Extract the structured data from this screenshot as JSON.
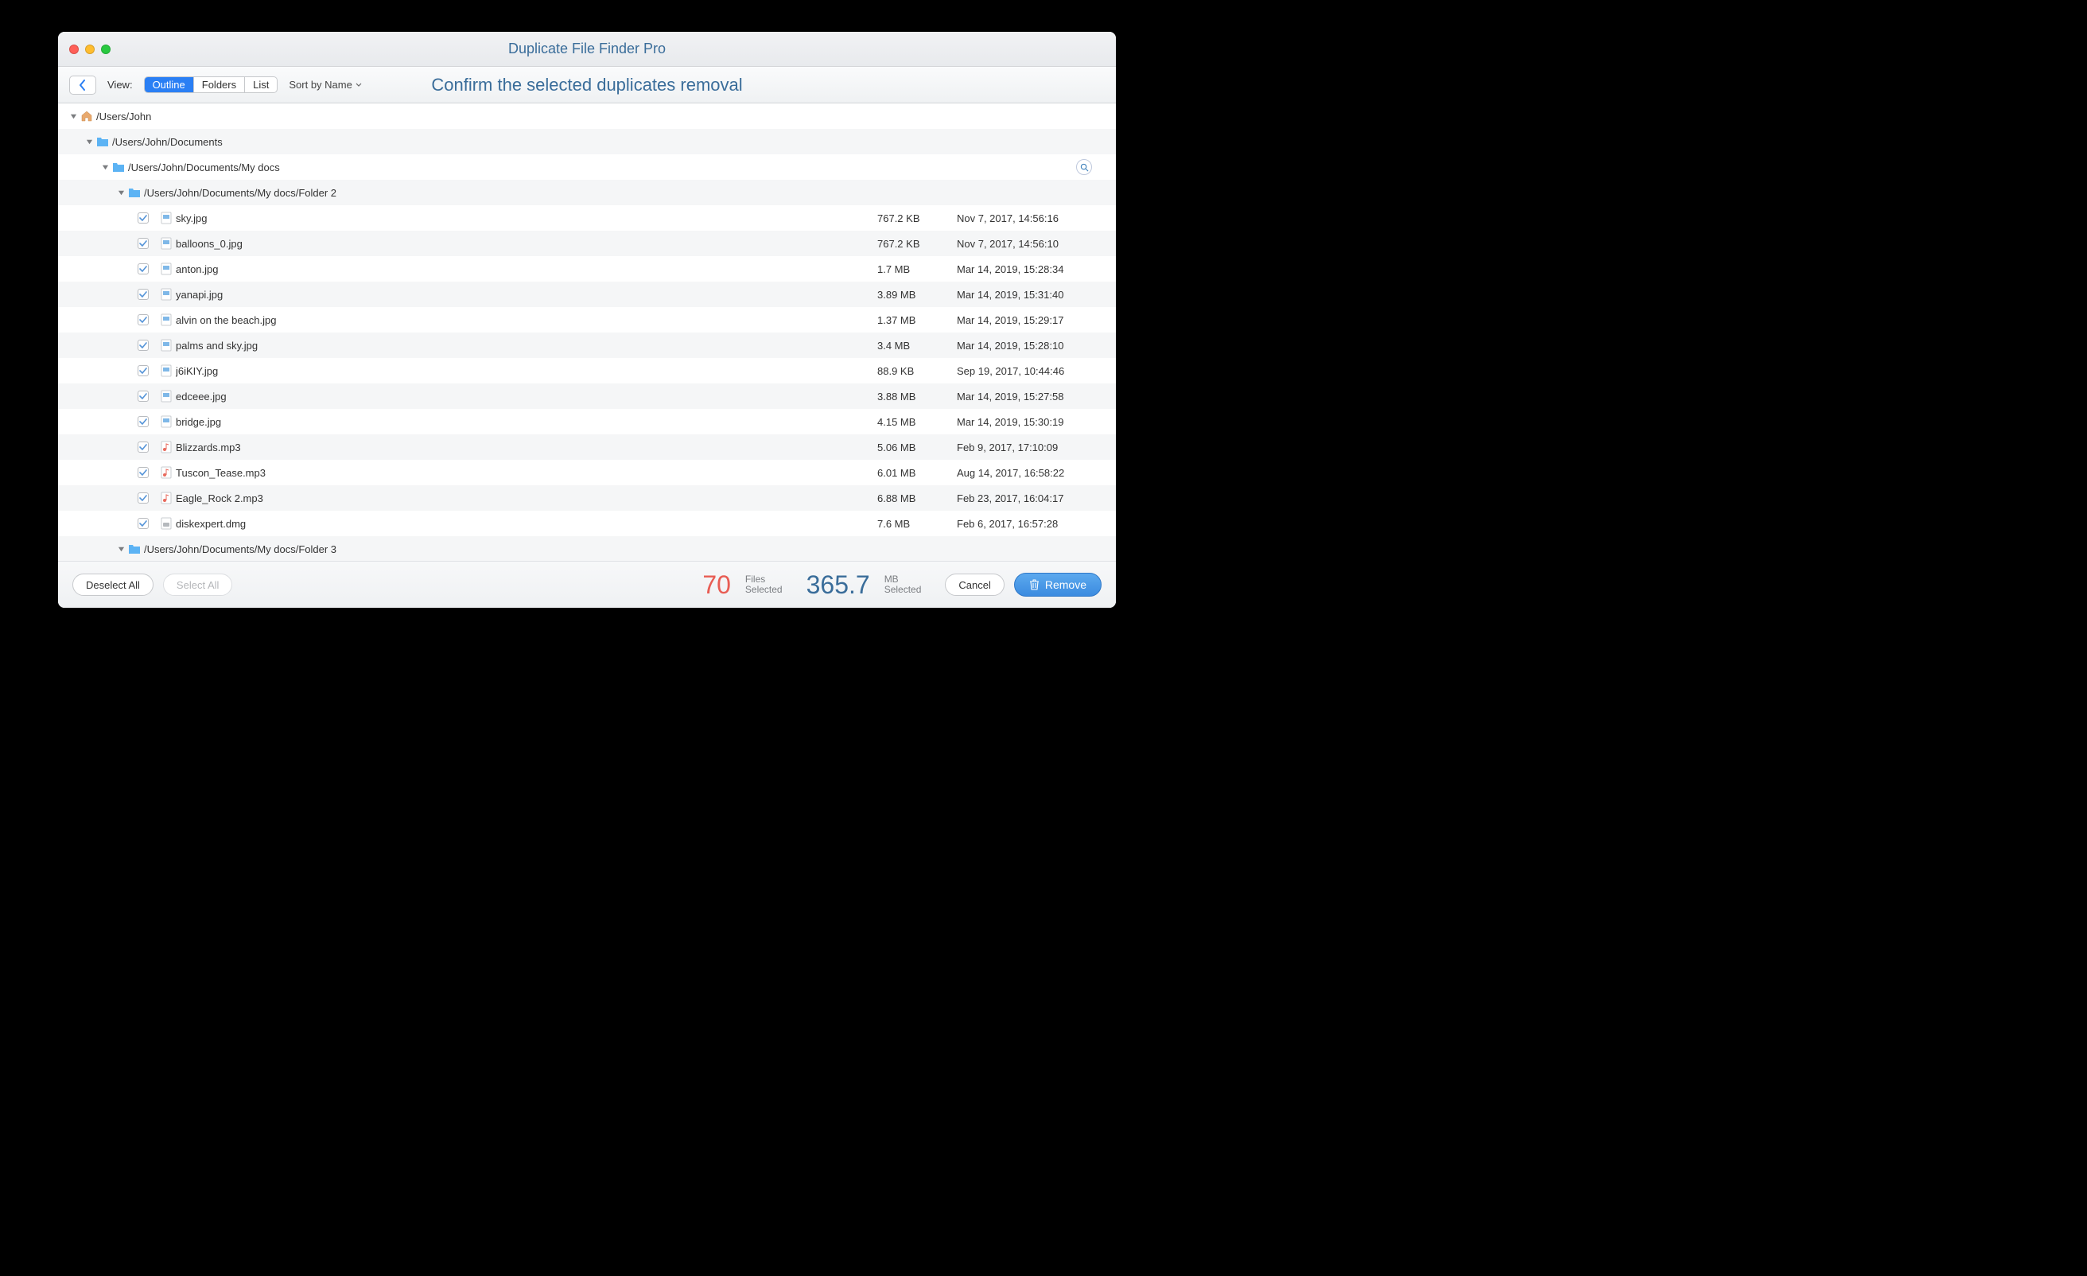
{
  "window": {
    "title": "Duplicate File Finder Pro"
  },
  "toolbar": {
    "view_label": "View:",
    "seg_outline": "Outline",
    "seg_folders": "Folders",
    "seg_list": "List",
    "sort_label": "Sort by Name",
    "headline": "Confirm the selected duplicates removal"
  },
  "tree": {
    "root": {
      "path": "/Users/John"
    },
    "lvl1": {
      "path": "/Users/John/Documents"
    },
    "lvl2": {
      "path": "/Users/John/Documents/My docs"
    },
    "lvl3a": {
      "path": "/Users/John/Documents/My docs/Folder 2"
    },
    "lvl3b": {
      "path": "/Users/John/Documents/My docs/Folder 3"
    }
  },
  "files": [
    {
      "name": "sky.jpg",
      "size": "767.2 KB",
      "date": "Nov 7, 2017, 14:56:16",
      "type": "image"
    },
    {
      "name": "balloons_0.jpg",
      "size": "767.2 KB",
      "date": "Nov 7, 2017, 14:56:10",
      "type": "image"
    },
    {
      "name": "anton.jpg",
      "size": "1.7 MB",
      "date": "Mar 14, 2019, 15:28:34",
      "type": "image"
    },
    {
      "name": "yanapi.jpg",
      "size": "3.89 MB",
      "date": "Mar 14, 2019, 15:31:40",
      "type": "image"
    },
    {
      "name": "alvin on the beach.jpg",
      "size": "1.37 MB",
      "date": "Mar 14, 2019, 15:29:17",
      "type": "image"
    },
    {
      "name": "palms and sky.jpg",
      "size": "3.4 MB",
      "date": "Mar 14, 2019, 15:28:10",
      "type": "image"
    },
    {
      "name": "j6iKIY.jpg",
      "size": "88.9 KB",
      "date": "Sep 19, 2017, 10:44:46",
      "type": "image"
    },
    {
      "name": "edceee.jpg",
      "size": "3.88 MB",
      "date": "Mar 14, 2019, 15:27:58",
      "type": "image"
    },
    {
      "name": "bridge.jpg",
      "size": "4.15 MB",
      "date": "Mar 14, 2019, 15:30:19",
      "type": "image"
    },
    {
      "name": "Blizzards.mp3",
      "size": "5.06 MB",
      "date": "Feb 9, 2017, 17:10:09",
      "type": "audio"
    },
    {
      "name": "Tuscon_Tease.mp3",
      "size": "6.01 MB",
      "date": "Aug 14, 2017, 16:58:22",
      "type": "audio"
    },
    {
      "name": "Eagle_Rock 2.mp3",
      "size": "6.88 MB",
      "date": "Feb 23, 2017, 16:04:17",
      "type": "audio"
    },
    {
      "name": "diskexpert.dmg",
      "size": "7.6 MB",
      "date": "Feb 6, 2017, 16:57:28",
      "type": "disk"
    }
  ],
  "footer": {
    "deselect": "Deselect All",
    "select": "Select All",
    "files_count": "70",
    "files_label_top": "Files",
    "files_label_bottom": "Selected",
    "size_value": "365.7",
    "size_label_top": "MB",
    "size_label_bottom": "Selected",
    "cancel": "Cancel",
    "remove": "Remove"
  }
}
